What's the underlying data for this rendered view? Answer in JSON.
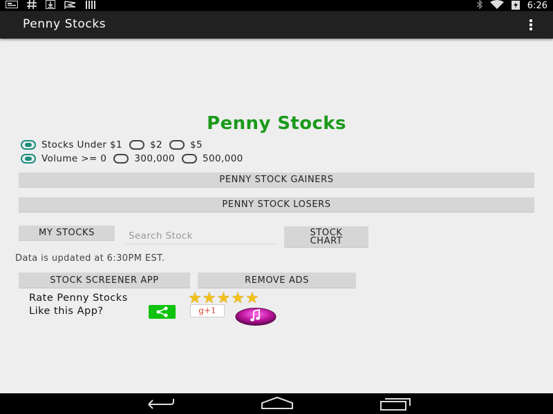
{
  "status_bar": {
    "time": "6:26",
    "left_icons": [
      "notification-card-icon",
      "hashtag-icon",
      "download-icon",
      "flag-icon",
      "barcode-icon"
    ],
    "right_icons": [
      "bluetooth-icon",
      "wifi-icon",
      "battery-charging-icon"
    ]
  },
  "app_bar": {
    "title": "Penny Stocks",
    "overflow_icon": "overflow-menu-icon"
  },
  "main": {
    "heading": "Penny Stocks",
    "heading_color": "#1a9a1a",
    "price_filter": {
      "options": [
        "Stocks Under $1",
        "$2",
        "$5"
      ],
      "selected": "Stocks Under $1"
    },
    "volume_filter": {
      "options": [
        "Volume >= 0",
        "300,000",
        "500,000"
      ],
      "selected": "Volume >= 0"
    },
    "gainers_button": "PENNY STOCK GAINERS",
    "losers_button": "PENNY STOCK LOSERS",
    "my_stocks_button": "MY STOCKS",
    "search_placeholder": "Search Stock",
    "stock_chart_button_line1": "STOCK",
    "stock_chart_button_line2": "CHART",
    "update_note": "Data is updated at 6:30PM EST.",
    "screener_button": "STOCK SCREENER APP",
    "remove_ads_button": "REMOVE ADS",
    "rate_label": "Rate Penny Stocks",
    "rating_stars": 5,
    "like_label": "Like this App?",
    "gplus_label": "g+1",
    "accent_color": "#1a8e7e"
  },
  "nav_bar": {
    "icons": [
      "back-icon",
      "home-icon",
      "recent-apps-icon"
    ]
  }
}
